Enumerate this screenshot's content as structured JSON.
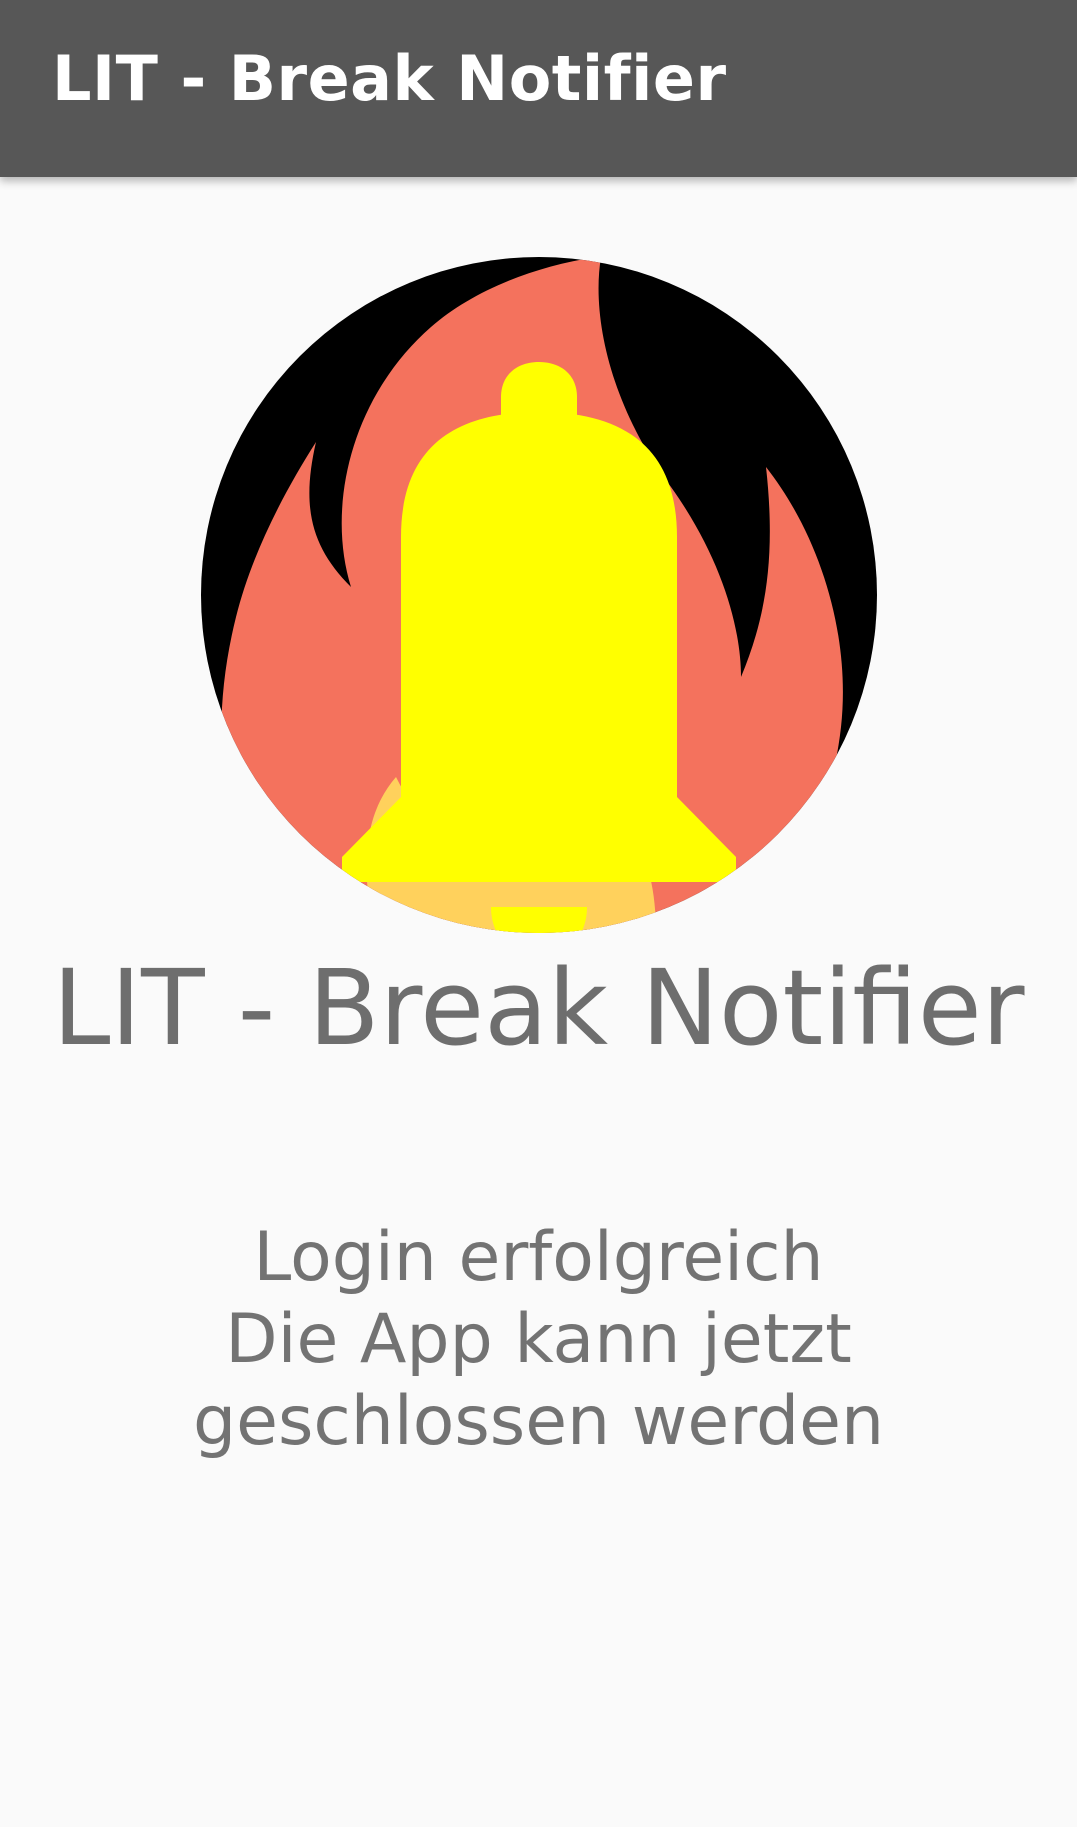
{
  "app_bar": {
    "title": "LIT - Break Notifier"
  },
  "main": {
    "logo_icon": "flame-bell-logo-icon",
    "app_name": "LIT - Break Notifier",
    "status_title": "Login erfolgreich",
    "status_message": "Die App kann jetzt geschlossen werden"
  },
  "colors": {
    "app_bar": "#575757",
    "background": "#fafafa",
    "text": "#6e6e6e",
    "logo_flame_outer": "#f4725d",
    "logo_flame_inner": "#ffd15c",
    "logo_bell": "#ffff00",
    "logo_background": "#000000"
  }
}
